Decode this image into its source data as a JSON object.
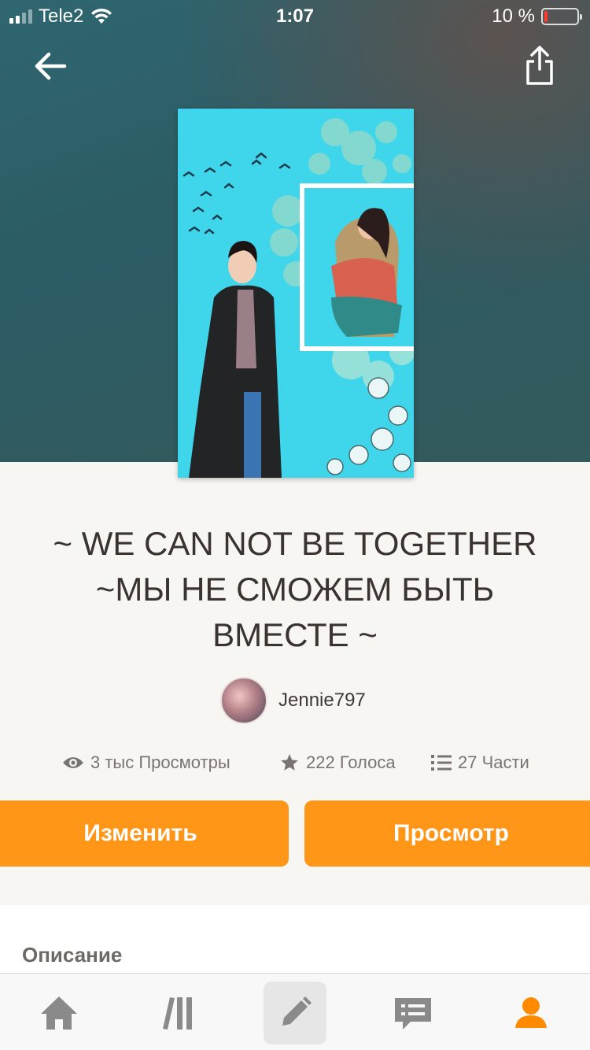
{
  "status_bar": {
    "carrier": "Tele2",
    "time": "1:07",
    "battery": "10 %",
    "battery_level": 0.1
  },
  "header": {
    "back_icon": "arrow-left-icon",
    "share_icon": "share-icon"
  },
  "story": {
    "title": "~ WE CAN NOT BE TOGETHER ~МЫ НЕ СМОЖЕМ БЫТЬ ВМЕСТЕ ~",
    "author": "Jennie797",
    "stats": {
      "views": "3 тыс Просмотры",
      "votes": "222 Голоса",
      "parts": "27 Части"
    }
  },
  "actions": {
    "edit_label": "Изменить",
    "view_label": "Просмотр"
  },
  "description": {
    "label": "Описание"
  },
  "tabbar": {
    "items": [
      "home-icon",
      "library-icon",
      "write-icon",
      "messages-icon",
      "profile-icon"
    ],
    "active": "write-icon"
  },
  "colors": {
    "accent": "#ff9618",
    "profile_active": "#ff8a00"
  }
}
